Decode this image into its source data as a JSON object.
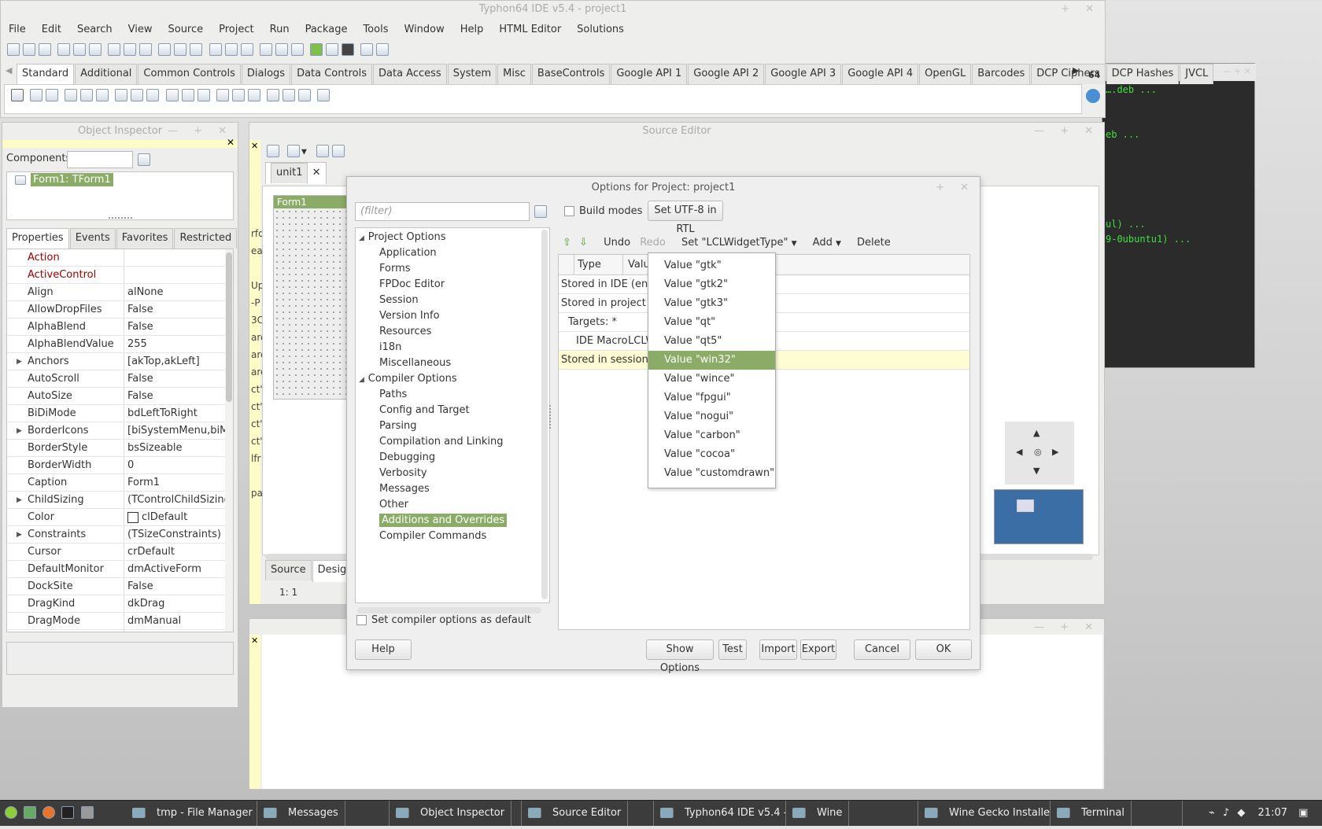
{
  "main_window": {
    "title": "Typhon64 IDE v5.4 - project1",
    "menu": [
      "File",
      "Edit",
      "Search",
      "View",
      "Source",
      "Project",
      "Run",
      "Package",
      "Tools",
      "Window",
      "Help",
      "HTML Editor",
      "Solutions"
    ],
    "palette_tabs": [
      "Standard",
      "Additional",
      "Common Controls",
      "Dialogs",
      "Data Controls",
      "Data Access",
      "System",
      "Misc",
      "BaseControls",
      "Google API 1",
      "Google API 2",
      "Google API 3",
      "Google API 4",
      "OpenGL",
      "Barcodes",
      "DCP Ciphers",
      "DCP Hashes",
      "JVCL"
    ],
    "arch_badge": "64"
  },
  "terminal_bg": {
    "lines": [
      "….deb ...",
      "",
      "",
      "eb ...",
      "",
      "",
      "",
      "",
      "",
      "ul) ...",
      "9-0ubuntu1) ..."
    ]
  },
  "object_inspector": {
    "title": "Object Inspector",
    "components_label": "Components",
    "tree_item": "Form1: TForm1",
    "tabs": [
      "Properties",
      "Events",
      "Favorites",
      "Restricted"
    ],
    "properties": [
      {
        "name": "Action",
        "value": "",
        "red": true,
        "exp": false
      },
      {
        "name": "ActiveControl",
        "value": "",
        "red": true,
        "exp": false
      },
      {
        "name": "Align",
        "value": "alNone",
        "red": false,
        "exp": false
      },
      {
        "name": "AllowDropFiles",
        "value": "False",
        "red": false,
        "exp": false
      },
      {
        "name": "AlphaBlend",
        "value": "False",
        "red": false,
        "exp": false
      },
      {
        "name": "AlphaBlendValue",
        "value": "255",
        "red": false,
        "exp": false
      },
      {
        "name": "Anchors",
        "value": "[akTop,akLeft]",
        "red": false,
        "exp": true
      },
      {
        "name": "AutoScroll",
        "value": "False",
        "red": false,
        "exp": false
      },
      {
        "name": "AutoSize",
        "value": "False",
        "red": false,
        "exp": false
      },
      {
        "name": "BiDiMode",
        "value": "bdLeftToRight",
        "red": false,
        "exp": false
      },
      {
        "name": "BorderIcons",
        "value": "[biSystemMenu,biMinir",
        "red": false,
        "exp": true
      },
      {
        "name": "BorderStyle",
        "value": "bsSizeable",
        "red": false,
        "exp": false
      },
      {
        "name": "BorderWidth",
        "value": "0",
        "red": false,
        "exp": false
      },
      {
        "name": "Caption",
        "value": "Form1",
        "red": false,
        "exp": false
      },
      {
        "name": "ChildSizing",
        "value": "(TControlChildSizing)",
        "red": false,
        "exp": true
      },
      {
        "name": "Color",
        "value": "clDefault",
        "red": false,
        "exp": false,
        "swatch": true
      },
      {
        "name": "Constraints",
        "value": "(TSizeConstraints)",
        "red": false,
        "exp": true
      },
      {
        "name": "Cursor",
        "value": "crDefault",
        "red": false,
        "exp": false
      },
      {
        "name": "DefaultMonitor",
        "value": "dmActiveForm",
        "red": false,
        "exp": false
      },
      {
        "name": "DockSite",
        "value": "False",
        "red": false,
        "exp": false
      },
      {
        "name": "DragKind",
        "value": "dkDrag",
        "red": false,
        "exp": false
      },
      {
        "name": "DragMode",
        "value": "dmManual",
        "red": false,
        "exp": false
      }
    ]
  },
  "source_editor": {
    "title": "Source Editor",
    "tab": "unit1",
    "form_caption": "Form1",
    "bottom_tabs": [
      "Source",
      "Designe"
    ],
    "status": "1:  1",
    "side_text": [
      "rfd",
      "ea",
      "",
      "Up",
      "-P",
      "3C",
      "are",
      "are",
      "are",
      "ct'",
      "ct'",
      "ct'",
      "ct'",
      "lfr",
      "",
      "pa"
    ]
  },
  "dialog": {
    "title": "Options for Project: project1",
    "filter_placeholder": "(filter)",
    "build_modes": "Build modes",
    "utf8_button": "Set UTF-8 in RTL",
    "tree": [
      {
        "label": "Project Options",
        "level": 0,
        "group": true
      },
      {
        "label": "Application",
        "level": 1
      },
      {
        "label": "Forms",
        "level": 1
      },
      {
        "label": "FPDoc Editor",
        "level": 1
      },
      {
        "label": "Session",
        "level": 1
      },
      {
        "label": "Version Info",
        "level": 1
      },
      {
        "label": "Resources",
        "level": 1
      },
      {
        "label": "i18n",
        "level": 1
      },
      {
        "label": "Miscellaneous",
        "level": 1
      },
      {
        "label": "Compiler Options",
        "level": 0,
        "group": true
      },
      {
        "label": "Paths",
        "level": 1
      },
      {
        "label": "Config and Target",
        "level": 1
      },
      {
        "label": "Parsing",
        "level": 1
      },
      {
        "label": "Compilation and Linking",
        "level": 1
      },
      {
        "label": "Debugging",
        "level": 1
      },
      {
        "label": "Verbosity",
        "level": 1
      },
      {
        "label": "Messages",
        "level": 1
      },
      {
        "label": "Other",
        "level": 1
      },
      {
        "label": "Additions and Overrides",
        "level": 1,
        "selected": true
      },
      {
        "label": "Compiler Commands",
        "level": 1
      }
    ],
    "toolbar": {
      "undo": "Undo",
      "redo": "Redo",
      "set_widget": "Set \"LCLWidgetType\"",
      "add": "Add",
      "delete": "Delete"
    },
    "grid_headers": [
      "Type",
      "Value"
    ],
    "grid_rows": [
      "Stored in IDE (environme",
      "Stored in project (.lpi)",
      "Targets: *",
      "",
      "Stored in session of proje"
    ],
    "grid_macro": {
      "type": "IDE Macro",
      "value": "LCLWidge"
    },
    "dropdown": [
      "Value \"gtk\"",
      "Value \"gtk2\"",
      "Value \"gtk3\"",
      "Value \"qt\"",
      "Value \"qt5\"",
      "Value \"win32\"",
      "Value \"wince\"",
      "Value \"fpgui\"",
      "Value \"nogui\"",
      "Value \"carbon\"",
      "Value \"cocoa\"",
      "Value \"customdrawn\""
    ],
    "dropdown_selected": 5,
    "set_default": "Set compiler options as default",
    "buttons": {
      "help": "Help",
      "show_options": "Show Options",
      "test": "Test",
      "import": "Import",
      "export": "Export",
      "cancel": "Cancel",
      "ok": "OK"
    }
  },
  "taskbar": {
    "items": [
      "tmp - File Manager",
      "Messages",
      "Object Inspector",
      "Source Editor",
      "Typhon64 IDE v5.4 - pr...",
      "Wine",
      "Wine Gecko Installer",
      "Terminal"
    ],
    "clock": "21:07"
  }
}
